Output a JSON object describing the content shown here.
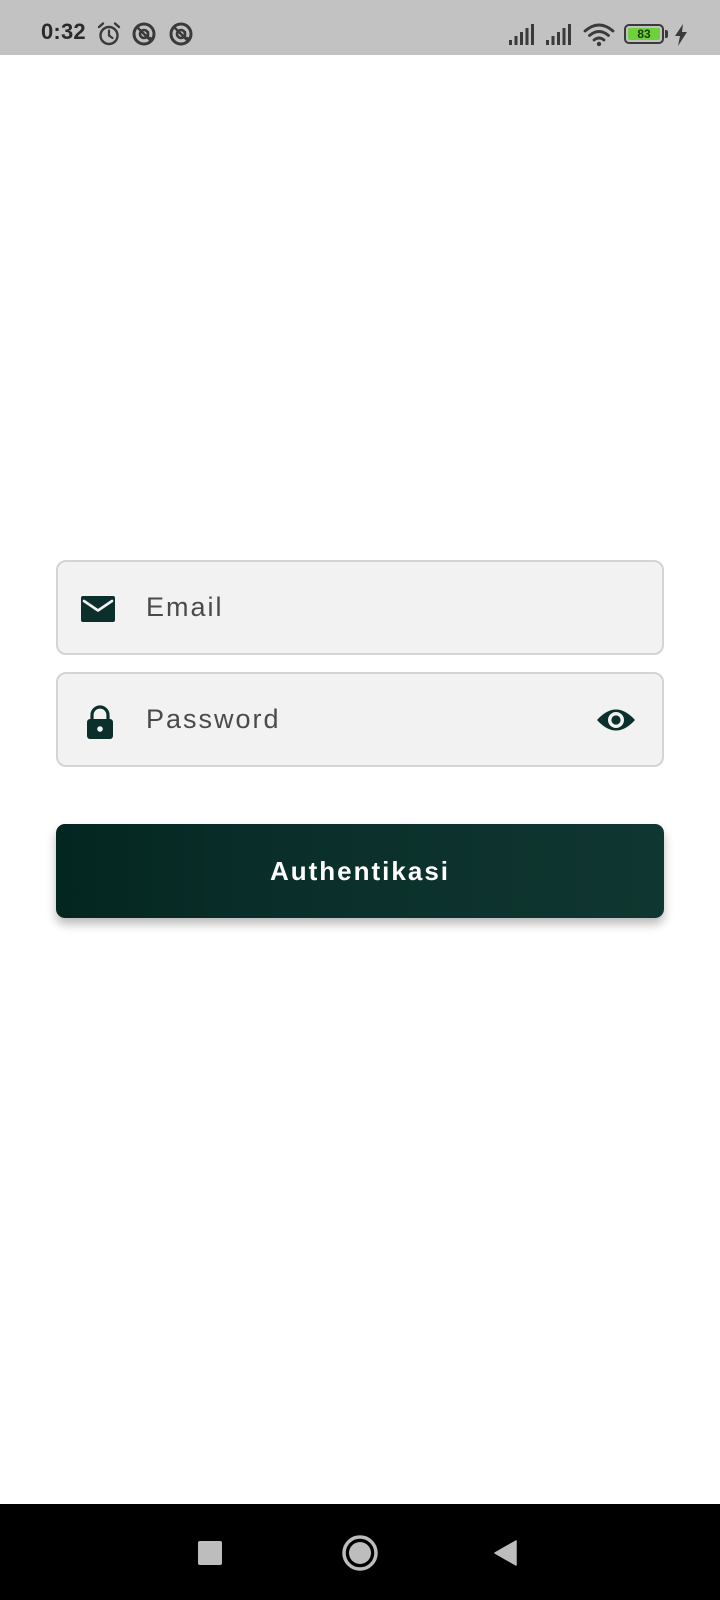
{
  "status_bar": {
    "time": "0:32",
    "battery_level": "83",
    "icons": [
      "alarm-icon",
      "at-sign-icon",
      "at-sign-icon",
      "signal-icon",
      "signal-icon",
      "wifi-icon",
      "battery-icon",
      "charging-bolt-icon"
    ]
  },
  "login_form": {
    "email_field": {
      "icon": "mail-icon",
      "placeholder": "Email",
      "value": ""
    },
    "password_field": {
      "icon": "lock-icon",
      "placeholder": "Password",
      "value": "",
      "toggle_icon": "eye-icon"
    },
    "submit_label": "Authentikasi"
  },
  "nav_bar": {
    "icons": [
      "recent-apps-icon",
      "home-icon",
      "back-icon"
    ]
  },
  "colors": {
    "primary": "#0b302b",
    "status_bar_bg": "#c2c2c2",
    "field_bg": "#f2f2f2",
    "field_border": "#d4d4d4",
    "battery_fill": "#6fd13a",
    "nav_bar_bg": "#000000"
  }
}
